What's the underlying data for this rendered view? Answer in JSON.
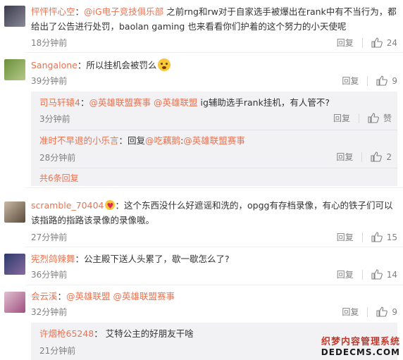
{
  "comments": [
    {
      "user": "怦怦怦心空",
      "mention": "@iG电子竞技俱乐部",
      "text": "之前rng和rw对于自家选手被爆出在rank中有不当行为，都给出了公告进行处罚，baolan gaming 也来看看你们护着的这个努力的小天使呢",
      "time": "18分钟前",
      "reply": "回复",
      "likes": "24"
    },
    {
      "user": "Sangalone",
      "text": "所以挂机会被罚么",
      "emoji": "思考",
      "time": "39分钟前",
      "reply": "回复",
      "likes": "9",
      "subreplies": [
        {
          "user": "司马轩辕4",
          "mention1": "@英雄联盟赛事",
          "mention2": "@英雄联盟",
          "text": "ig辅助选手rank挂机，有人管不?",
          "time": "3分钟前",
          "reply": "回复",
          "likes": "赞"
        },
        {
          "user": "准时不早退的小乐言",
          "prefix": "回复",
          "mention1": "@吃藕鹅",
          "colon": ":",
          "mention2": "@英雄联盟赛事",
          "time": "28分钟前",
          "reply": "回复",
          "likes": "2"
        }
      ],
      "more": "共6条回复"
    },
    {
      "user": "scramble_70404",
      "text": "这个东西没什么好遮谣和洗的，opgg有存档录像，有心的铁子们可以该指路的指路该录像的录像嗷。",
      "time": "27分钟前",
      "reply": "回复",
      "likes": "15"
    },
    {
      "user": "宪烈鸽辣舞",
      "text": "公主殿下送人头累了，歇一歇怎么了?",
      "time": "36分钟前",
      "reply": "回复",
      "likes": "14"
    },
    {
      "user": "会云溪",
      "mention1": "@英雄联盟",
      "mention2": "@英雄联盟赛事",
      "time": "32分钟前",
      "reply": "回复",
      "likes": "9",
      "subreplies": [
        {
          "user": "许烟枪65248",
          "text": "艾特公主的好朋友干啥",
          "time": "21分钟前"
        }
      ]
    }
  ],
  "colors": {
    "accent": "#eb7350",
    "muted": "#808080",
    "subbg": "#f2f2f5"
  },
  "watermark": {
    "line1": "织梦内容管理系统",
    "line2": "DEDECMS.COM"
  }
}
